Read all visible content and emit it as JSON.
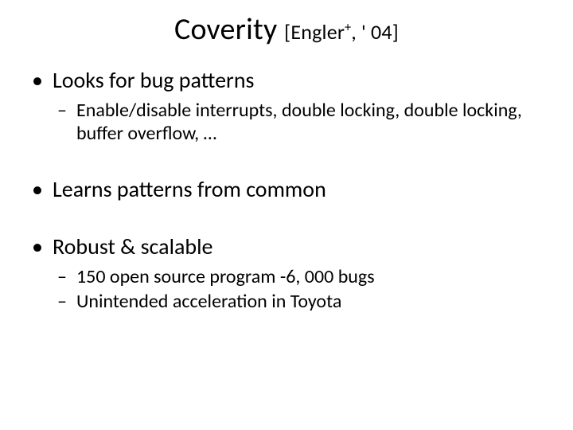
{
  "title": {
    "main": "Coverity",
    "citation_prefix": "[Engler",
    "citation_sup": "+",
    "citation_suffix": ", ' 04]"
  },
  "bullets": [
    {
      "text": "Looks for bug patterns",
      "sub": [
        "Enable/disable interrupts, double locking, double locking, buffer overflow, …"
      ]
    },
    {
      "text": "Learns patterns from common",
      "sub": []
    },
    {
      "text": "Robust & scalable",
      "sub": [
        "150 open source program -6, 000 bugs",
        "Unintended acceleration in Toyota"
      ]
    }
  ]
}
